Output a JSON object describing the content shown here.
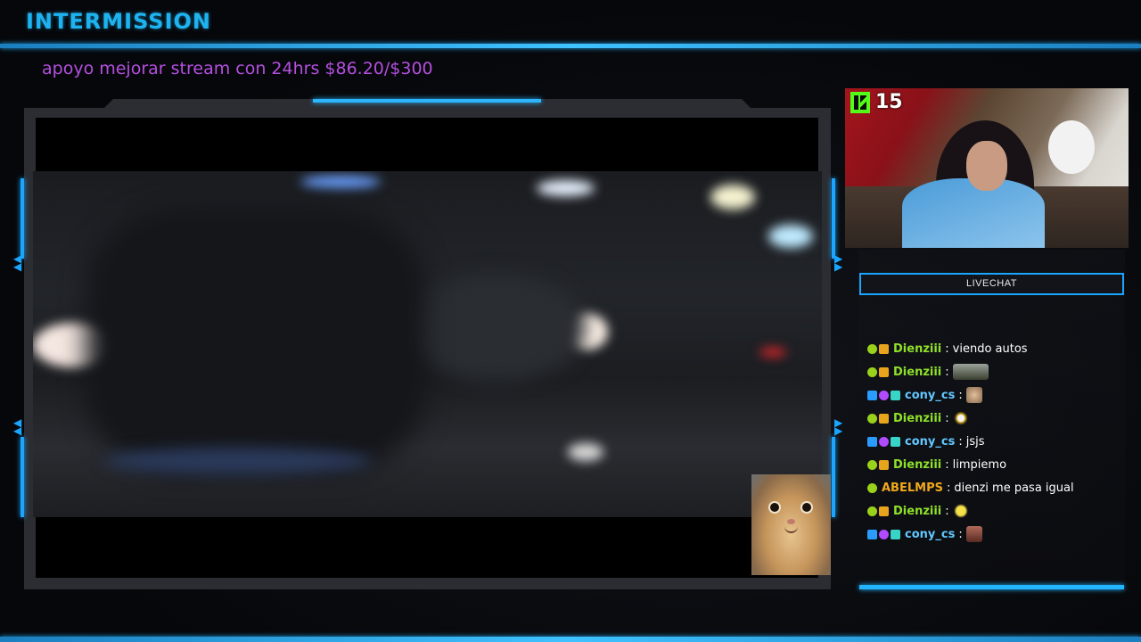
{
  "header": {
    "title": "INTERMISSION"
  },
  "goal": {
    "text": "apoyo mejorar stream con 24hrs $86.20/$300"
  },
  "webcam": {
    "platform_icon": "kick-icon",
    "viewer_count": "15"
  },
  "chat": {
    "header_label": "LIVECHAT",
    "messages": [
      {
        "user": "Dienziii",
        "color": "#8fe02a",
        "badges": [
          "og",
          "sub"
        ],
        "text": "viendo autos",
        "emote": ""
      },
      {
        "user": "Dienziii",
        "color": "#8fe02a",
        "badges": [
          "og",
          "sub"
        ],
        "text": "",
        "emote": "emote-car"
      },
      {
        "user": "cony_cs",
        "color": "#62c8ff",
        "badges": [
          "vip",
          "mod",
          "gift"
        ],
        "text": "",
        "emote": "emote-cat"
      },
      {
        "user": "Dienziii",
        "color": "#8fe02a",
        "badges": [
          "og",
          "sub"
        ],
        "text": "",
        "emote": "emote-dance"
      },
      {
        "user": "cony_cs",
        "color": "#62c8ff",
        "badges": [
          "vip",
          "mod",
          "gift"
        ],
        "text": "jsjs",
        "emote": ""
      },
      {
        "user": "Dienziii",
        "color": "#8fe02a",
        "badges": [
          "og",
          "sub"
        ],
        "text": "limpiemo",
        "emote": ""
      },
      {
        "user": "ABELMPS",
        "color": "#f0a81c",
        "badges": [
          "og"
        ],
        "text": "dienzi me pasa igual",
        "emote": ""
      },
      {
        "user": "Dienziii",
        "color": "#8fe02a",
        "badges": [
          "og",
          "sub"
        ],
        "text": "",
        "emote": "emote-sponge"
      },
      {
        "user": "cony_cs",
        "color": "#62c8ff",
        "badges": [
          "vip",
          "mod",
          "gift"
        ],
        "text": "",
        "emote": "emote-face"
      }
    ]
  },
  "colors": {
    "accent": "#1eb3f0",
    "goal": "#b44fe0"
  }
}
